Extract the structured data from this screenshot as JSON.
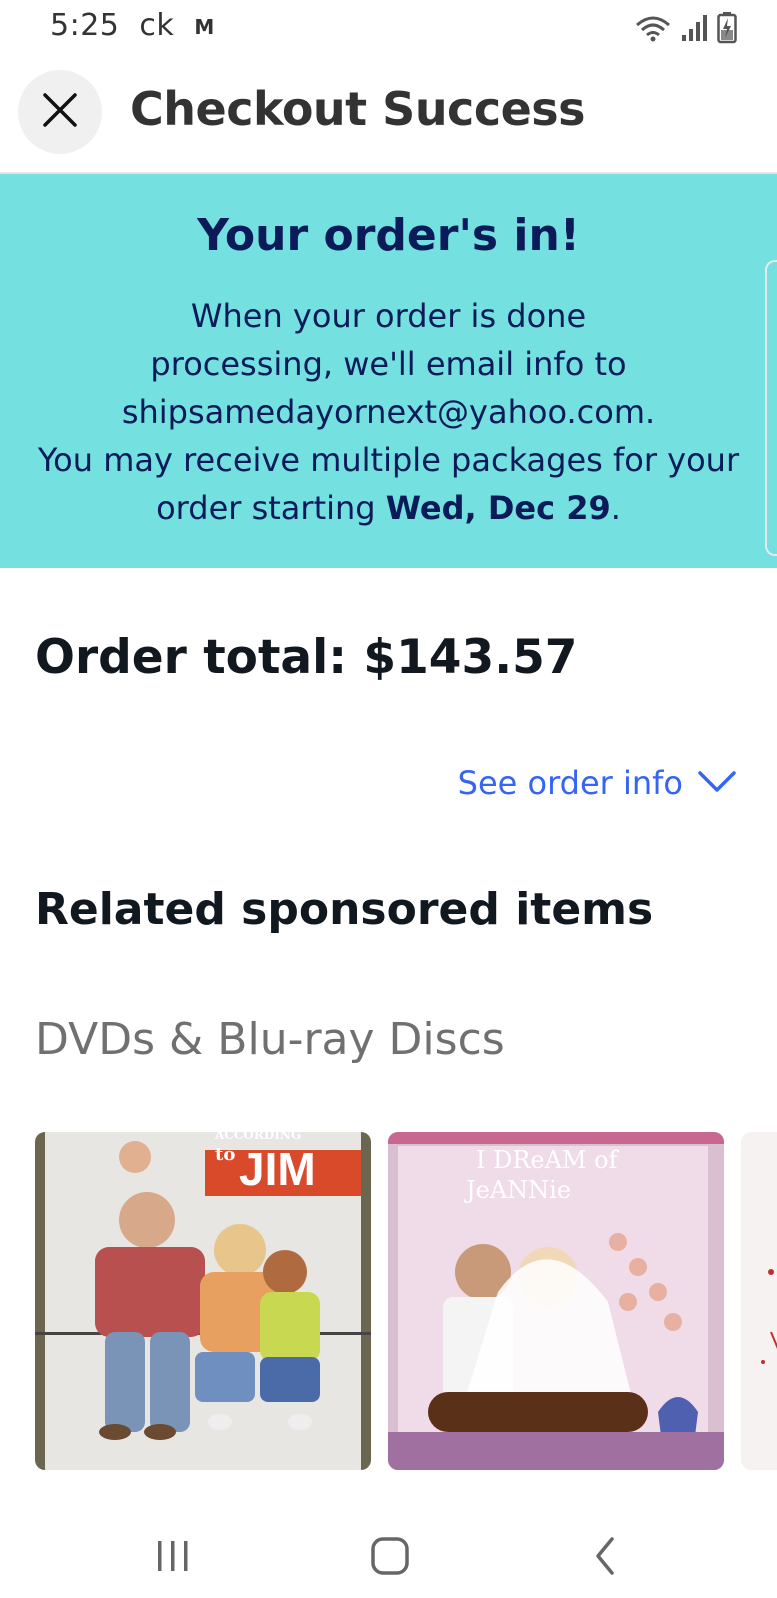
{
  "status_bar": {
    "time": "5:25",
    "carrier_text": "ck",
    "notification_glyph": "M"
  },
  "header": {
    "title": "Checkout Success"
  },
  "banner": {
    "heading": "Your order's in!",
    "line1": "When your order is done",
    "line2": "processing, we'll email info to",
    "email": "shipsamedayornext@yahoo.com.",
    "line4": "You may receive multiple packages for your",
    "line5_prefix": "order starting ",
    "delivery_date": "Wed, Dec 29",
    "line5_suffix": ".",
    "background_color": "#74e0df",
    "text_color": "#0b1b5a"
  },
  "order": {
    "total_label": "Order total: $143.57",
    "see_order_info": "See order info"
  },
  "related": {
    "heading": "Related sponsored items",
    "category": "DVDs & Blu-ray Discs",
    "items": [
      {
        "cover_title_top": "ACCORDING",
        "cover_title_mid": "to",
        "cover_title_main": "JIM",
        "icon": "dvd-cover-image"
      },
      {
        "cover_title_top": "I DReAM of",
        "cover_title_main": "JeANNie",
        "icon": "dvd-cover-image"
      }
    ]
  },
  "colors": {
    "link": "#3665f3",
    "accent_banner": "#74e0df"
  }
}
